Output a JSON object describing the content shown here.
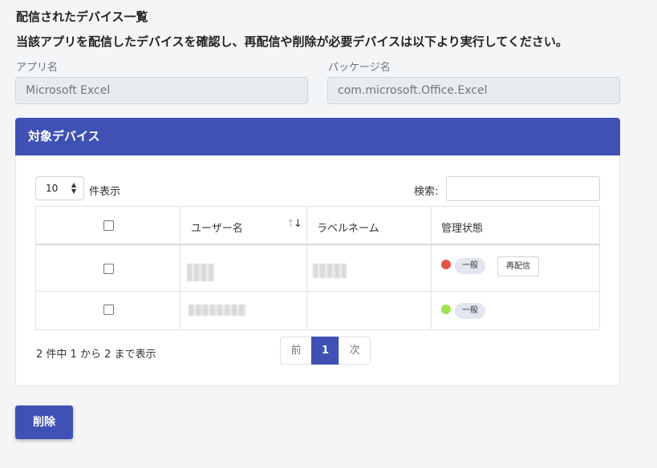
{
  "page": {
    "title": "配信されたデバイス一覧",
    "description": "当該アプリを配信したデバイスを確認し、再配信や削除が必要デバイスは以下より実行してください。"
  },
  "fields": {
    "app_name_label": "アプリ名",
    "app_name_value": "Microsoft Excel",
    "package_name_label": "パッケージ名",
    "package_name_value": "com.microsoft.Office.Excel"
  },
  "card": {
    "title": "対象デバイス"
  },
  "table_controls": {
    "page_length_value": "10",
    "page_length_label": "件表示",
    "search_label": "検索:",
    "search_value": ""
  },
  "table": {
    "columns": [
      "",
      "ユーザー名",
      "ラベルネーム",
      "管理状態"
    ],
    "rows": [
      {
        "status_color": "#e5534b",
        "status_badge": "一般",
        "action_label": "再配信"
      },
      {
        "status_color": "#9ee44a",
        "status_badge": "一般"
      }
    ]
  },
  "footer": {
    "info": "2 件中 1 から 2 まで表示",
    "prev_label": "前",
    "current_page": "1",
    "next_label": "次"
  },
  "actions": {
    "delete_label": "削除"
  },
  "colors": {
    "primary": "#3f51b5"
  }
}
